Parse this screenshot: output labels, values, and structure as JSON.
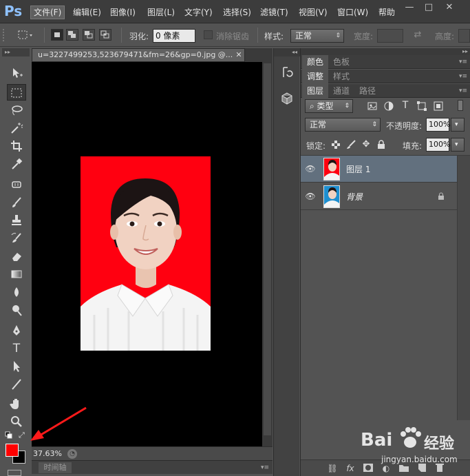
{
  "app": {
    "logo": "Ps"
  },
  "menu": [
    "文件(F)",
    "编辑(E)",
    "图像(I)",
    "图层(L)",
    "文字(Y)",
    "选择(S)",
    "滤镜(T)",
    "视图(V)",
    "窗口(W)",
    "帮助"
  ],
  "window_controls": [
    "—",
    "□",
    "✕"
  ],
  "options": {
    "feather_label": "羽化:",
    "feather_value": "0 像素",
    "antialias_label": "消除锯齿",
    "style_label": "样式:",
    "style_value": "正常",
    "width_label": "宽度:",
    "height_label": "高度:"
  },
  "document": {
    "tab_title": "u=3227499253,523679471&fm=26&gp=0.jpg @...",
    "zoom": "37.63%",
    "timeline_label": "时间轴"
  },
  "colors": {
    "foreground": "#ff0000",
    "background": "#000000",
    "photo_background": "#ff0010"
  },
  "panels": {
    "group1_tabs": [
      "颜色",
      "色板"
    ],
    "group2_tabs": [
      "调整",
      "样式"
    ],
    "layers_tabs": [
      "图层",
      "通道",
      "路径"
    ],
    "filter_kind": "类型",
    "blend_mode": "正常",
    "opacity_label": "不透明度:",
    "opacity_value": "100%",
    "lock_label": "锁定:",
    "fill_label": "填充:",
    "fill_value": "100%",
    "layers": [
      {
        "name": "图层 1",
        "selected": true,
        "locked": false
      },
      {
        "name": "背景",
        "selected": false,
        "locked": true
      }
    ]
  },
  "watermark": {
    "brand": "Bai",
    "brand2": "经验",
    "url": "jingyan.baidu.com"
  }
}
